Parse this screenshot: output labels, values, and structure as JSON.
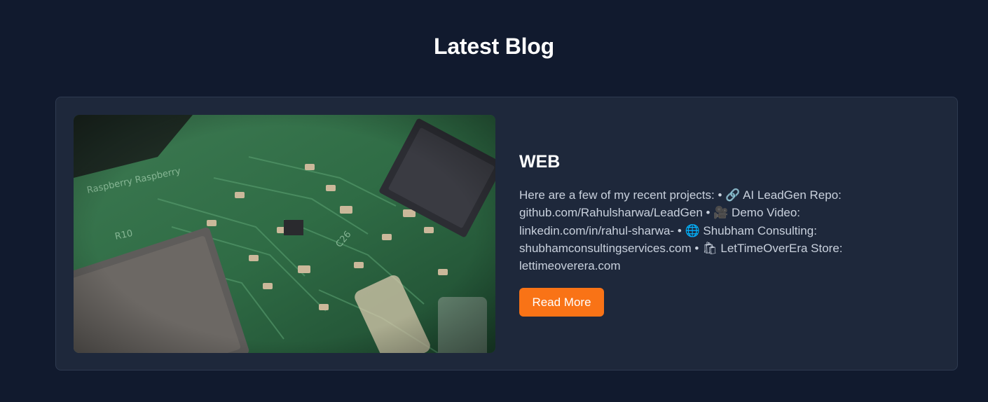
{
  "section": {
    "title": "Latest Blog"
  },
  "post": {
    "image_alt": "circuit board photo",
    "title": "WEB",
    "description_lines": [
      "Here are a few of my recent projects: • 🔗 AI LeadGen Repo:",
      "github.com/Rahulsharwa/LeadGen • 🎥 Demo Video:",
      "linkedin.com/in/rahul-sharwa- • 🌐 Shubham Consulting:",
      "shubhamconsultingservices.com • 🛍 LetTimeOverEra Store:",
      "lettimeoverera.com"
    ],
    "read_more_label": "Read More"
  },
  "colors": {
    "page_bg": "#111a2e",
    "card_bg": "#1e283b",
    "accent": "#f97316"
  },
  "icons": [
    "link-icon",
    "video-camera-icon",
    "globe-icon",
    "shopping-bags-icon"
  ]
}
